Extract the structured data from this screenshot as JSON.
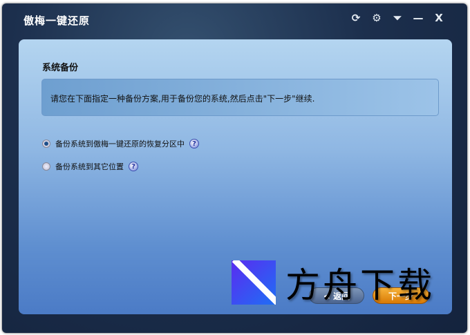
{
  "window": {
    "title": "傲梅一键还原",
    "controls": [
      {
        "name": "refresh-icon",
        "glyph": "⟳"
      },
      {
        "name": "gear-icon",
        "glyph": "⚙"
      },
      {
        "name": "menu-down-icon",
        "glyph": "⏷"
      },
      {
        "name": "minimize-icon",
        "glyph": "—"
      },
      {
        "name": "close-icon",
        "glyph": "X"
      }
    ]
  },
  "panel": {
    "title": "系统备份",
    "info": "请您在下面指定一种备份方案,用于备份您的系统,然后点击\"下一步\"继续.",
    "options": [
      {
        "label": "备份系统到傲梅一键还原的恢复分区中",
        "selected": true
      },
      {
        "label": "备份系统到其它位置",
        "selected": false
      }
    ],
    "help": "?",
    "back": "< 返回",
    "next": "下一步"
  },
  "watermark": "方舟下载"
}
